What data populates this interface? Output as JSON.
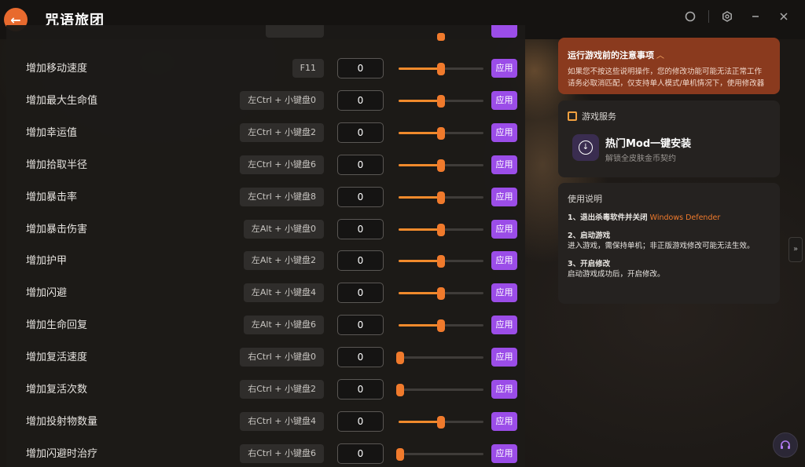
{
  "app": {
    "title": "咒语旅团",
    "back_icon": "arrow-left-icon"
  },
  "window_controls": [
    {
      "name": "user-icon",
      "glyph": "◯"
    },
    {
      "name": "settings-icon",
      "glyph": "⬡"
    },
    {
      "name": "minimize-icon",
      "glyph": "—"
    },
    {
      "name": "close-icon",
      "glyph": "✕"
    }
  ],
  "cheats": [
    {
      "label": "增加移动速度",
      "hotkey": "F11",
      "value": "0",
      "level": 0.5,
      "apply": "应用"
    },
    {
      "label": "增加最大生命值",
      "hotkey": "左Ctrl + 小键盘0",
      "value": "0",
      "level": 0.5,
      "apply": "应用"
    },
    {
      "label": "增加幸运值",
      "hotkey": "左Ctrl + 小键盘2",
      "value": "0",
      "level": 0.5,
      "apply": "应用"
    },
    {
      "label": "增加拾取半径",
      "hotkey": "左Ctrl + 小键盘6",
      "value": "0",
      "level": 0.5,
      "apply": "应用"
    },
    {
      "label": "增加暴击率",
      "hotkey": "左Ctrl + 小键盘8",
      "value": "0",
      "level": 0.5,
      "apply": "应用"
    },
    {
      "label": "增加暴击伤害",
      "hotkey": "左Alt + 小键盘0",
      "value": "0",
      "level": 0.5,
      "apply": "应用"
    },
    {
      "label": "增加护甲",
      "hotkey": "左Alt + 小键盘2",
      "value": "0",
      "level": 0.5,
      "apply": "应用"
    },
    {
      "label": "增加闪避",
      "hotkey": "左Alt + 小键盘4",
      "value": "0",
      "level": 0.5,
      "apply": "应用"
    },
    {
      "label": "增加生命回复",
      "hotkey": "左Alt + 小键盘6",
      "value": "0",
      "level": 0.5,
      "apply": "应用"
    },
    {
      "label": "增加复活速度",
      "hotkey": "右Ctrl + 小键盘0",
      "value": "0",
      "level": 0.0,
      "apply": "应用"
    },
    {
      "label": "增加复活次数",
      "hotkey": "右Ctrl + 小键盘2",
      "value": "0",
      "level": 0.0,
      "apply": "应用"
    },
    {
      "label": "增加投射物数量",
      "hotkey": "右Ctrl + 小键盘4",
      "value": "0",
      "level": 0.5,
      "apply": "应用"
    },
    {
      "label": "增加闪避时治疗",
      "hotkey": "右Ctrl + 小键盘6",
      "value": "0",
      "level": 0.0,
      "apply": "应用"
    }
  ],
  "notice": {
    "title": "运行游戏前的注意事项",
    "line1": "如果您不按这些说明操作，您的修改功能可能无法正常工作",
    "line2": "请务必取消匹配，仅支持单人模式/单机情况下，使用修改器"
  },
  "service": {
    "heading": "游戏服务",
    "mod_title": "热门Mod一键安装",
    "mod_subtitle": "解锁全皮肤金币契约"
  },
  "guide": {
    "heading": "使用说明",
    "step1_prefix": "1、退出杀毒软件并关闭",
    "step1_accent": "Windows Defender",
    "step2_title": "2、启动游戏",
    "step2_text": "进入游戏，需保持单机；非正版游戏修改可能无法生效。",
    "step3_title": "3、开启修改",
    "step3_text": "启动游戏成功后，开启修改。"
  },
  "colors": {
    "accent_orange": "#f07a2c",
    "apply_purple": "#9b4de8",
    "notice_bg": "#8a3a1e"
  }
}
